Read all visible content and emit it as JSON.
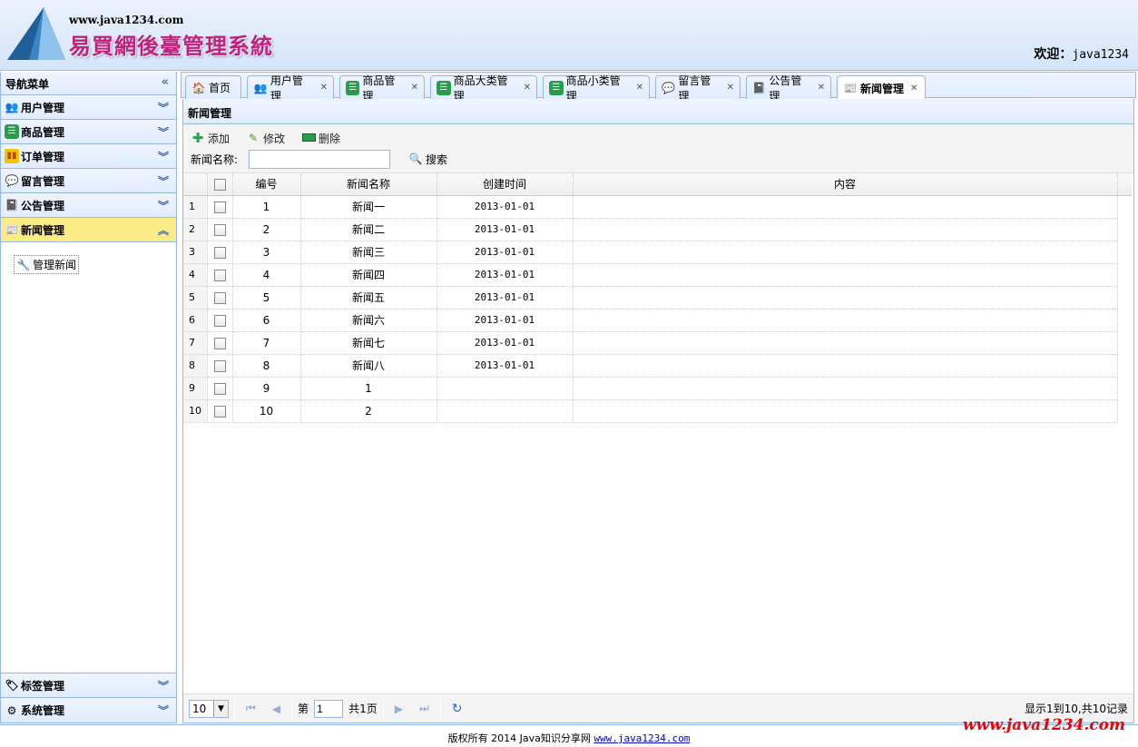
{
  "header": {
    "site_url": "www.java1234.com",
    "site_title": "易買網後臺管理系統",
    "welcome_label": "欢迎：",
    "username": "java1234"
  },
  "sidebar": {
    "title": "导航菜单",
    "collapse_icon": "«",
    "items": [
      {
        "label": "用户管理",
        "icon": "users-icon"
      },
      {
        "label": "商品管理",
        "icon": "list-icon"
      },
      {
        "label": "订单管理",
        "icon": "order-icon"
      },
      {
        "label": "留言管理",
        "icon": "comment-icon"
      },
      {
        "label": "公告管理",
        "icon": "notice-icon"
      },
      {
        "label": "新闻管理",
        "icon": "news-icon",
        "selected": true
      }
    ],
    "sub_item": "管理新闻",
    "bottom_items": [
      {
        "label": "标签管理",
        "icon": "tag-icon"
      },
      {
        "label": "系统管理",
        "icon": "gear-icon"
      }
    ]
  },
  "tabs": [
    {
      "label": "首页",
      "icon": "home-icon",
      "closable": false
    },
    {
      "label": "用户管理",
      "icon": "users-icon",
      "closable": true
    },
    {
      "label": "商品管理",
      "icon": "list-icon",
      "closable": true
    },
    {
      "label": "商品大类管理",
      "icon": "list-icon",
      "closable": true
    },
    {
      "label": "商品小类管理",
      "icon": "list-icon",
      "closable": true
    },
    {
      "label": "留言管理",
      "icon": "comment-icon",
      "closable": true
    },
    {
      "label": "公告管理",
      "icon": "notice-icon",
      "closable": true
    },
    {
      "label": "新闻管理",
      "icon": "news-icon",
      "closable": true,
      "active": true
    }
  ],
  "panel": {
    "title": "新闻管理",
    "toolbar": {
      "add_label": "添加",
      "edit_label": "修改",
      "delete_label": "删除",
      "search_label": "新闻名称:",
      "search_value": "",
      "search_button": "搜索"
    },
    "grid": {
      "columns": [
        "编号",
        "新闻名称",
        "创建时间",
        "内容"
      ],
      "rows": [
        {
          "n": "1",
          "id": "1",
          "name": "新闻一",
          "date": "2013-01-01",
          "content": ""
        },
        {
          "n": "2",
          "id": "2",
          "name": "新闻二",
          "date": "2013-01-01",
          "content": ""
        },
        {
          "n": "3",
          "id": "3",
          "name": "新闻三",
          "date": "2013-01-01",
          "content": ""
        },
        {
          "n": "4",
          "id": "4",
          "name": "新闻四",
          "date": "2013-01-01",
          "content": ""
        },
        {
          "n": "5",
          "id": "5",
          "name": "新闻五",
          "date": "2013-01-01",
          "content": ""
        },
        {
          "n": "6",
          "id": "6",
          "name": "新闻六",
          "date": "2013-01-01",
          "content": ""
        },
        {
          "n": "7",
          "id": "7",
          "name": "新闻七",
          "date": "2013-01-01",
          "content": ""
        },
        {
          "n": "8",
          "id": "8",
          "name": "新闻八",
          "date": "2013-01-01",
          "content": ""
        },
        {
          "n": "9",
          "id": "9",
          "name": "1",
          "date": "",
          "content": ""
        },
        {
          "n": "10",
          "id": "10",
          "name": "2",
          "date": "",
          "content": ""
        }
      ]
    },
    "pager": {
      "page_size": "10",
      "page_prefix": "第",
      "page_value": "1",
      "page_suffix": "共1页",
      "info": "显示1到10,共10记录"
    }
  },
  "footer": {
    "text": "版权所有 2014 Java知识分享网",
    "link": "www.java1234.com"
  },
  "watermark": "www.java1234.com",
  "colors": {
    "border": "#95b8e7",
    "selected": "#fbec88",
    "title": "#c02080"
  }
}
